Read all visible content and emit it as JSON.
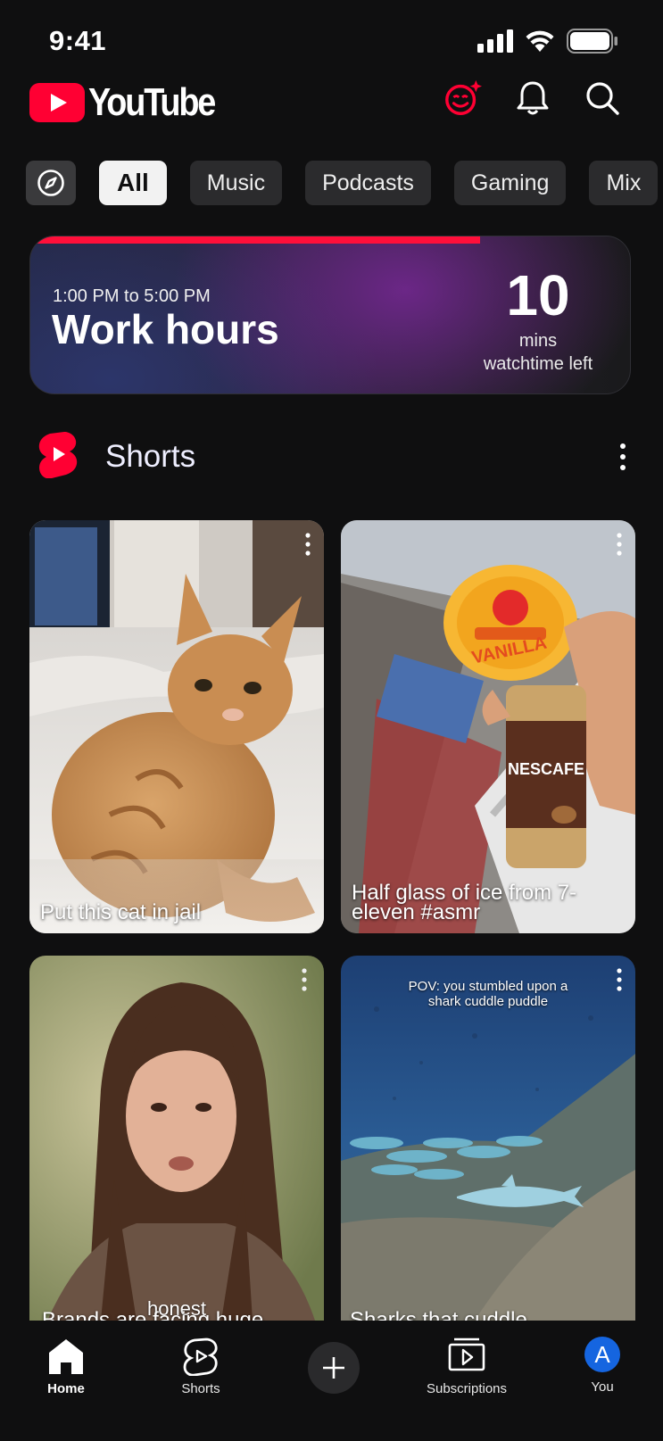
{
  "status_bar": {
    "time": "9:41"
  },
  "header": {
    "logo_text": "YouTube",
    "icons": [
      "wellbeing-icon",
      "bell-icon",
      "search-icon"
    ],
    "brand_color": "#ff0033"
  },
  "chips": [
    "All",
    "Music",
    "Podcasts",
    "Gaming",
    "Mix"
  ],
  "banner": {
    "time_range": "1:00 PM to 5:00 PM",
    "title": "Work hours",
    "remaining_value": "10",
    "remaining_unit": "mins",
    "remaining_label": "watchtime left",
    "progress_fraction": 0.75,
    "progress_color": "#ff0f3a"
  },
  "shorts": {
    "section_title": "Shorts",
    "cards": [
      {
        "caption": "Put this cat in jail",
        "thumb_icon": "cat-thumbnail"
      },
      {
        "caption": "Half glass of ice from 7-eleven #asmr",
        "thumb_icon": "vanilla-ice-cream-thumbnail"
      },
      {
        "caption": "Brands are facing huge",
        "overlay": "honest",
        "thumb_icon": "woman-portrait-thumbnail"
      },
      {
        "caption": "Sharks that cuddle",
        "overlay": "POV: you stumbled upon a shark cuddle puddle",
        "thumb_icon": "shark-reef-thumbnail"
      }
    ]
  },
  "bottom_nav": {
    "items": [
      {
        "label": "Home",
        "icon": "home-icon",
        "active": true
      },
      {
        "label": "Shorts",
        "icon": "shorts-icon",
        "active": false
      },
      {
        "label": "",
        "icon": "plus-icon",
        "active": false
      },
      {
        "label": "Subscriptions",
        "icon": "subscriptions-icon",
        "active": false
      },
      {
        "label": "You",
        "icon": "avatar-icon",
        "avatar_letter": "A",
        "active": false
      }
    ]
  }
}
